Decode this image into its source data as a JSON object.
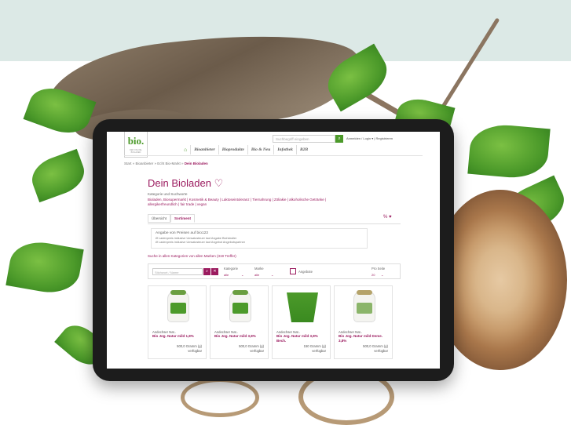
{
  "site": {
    "logo_text": "bio.",
    "logo_sub": "DER ONLINE-BIOLADEN",
    "search_placeholder": "Suchbegriff eingeben",
    "search_icon": "search-icon",
    "top_right": "Anmelden / Login ▾  |  Registrieren",
    "home_icon": "home-icon",
    "nav": [
      "Bioanbieter",
      "Bioprodukte",
      "Bio & Neu",
      "Infothek",
      "B2B"
    ]
  },
  "breadcrumb": {
    "path": "Start » Bioanbieter » Echt Bio-Markt » ",
    "current": "Dein Bioladen"
  },
  "page": {
    "title": "Dein Bioladen",
    "heart_icon": "heart-icon",
    "categories_label": "Kategorie und Suchworte",
    "categories": "Bioladen, Biosupermarkt | Kosmetik & Beauty | Laktoseintoleranz | Tiernahrung | Zöliakie | alkoholische Getränke | allergikerfreundlich | fair trade | vegan"
  },
  "tabs": {
    "items": [
      "Übersicht",
      "Sortiment"
    ],
    "active": 1,
    "icons": "% ♥"
  },
  "info": {
    "heading": "Angabe von Preisen auf bio123",
    "line1": "Ø Ladenpreis inklusive Umsatzsteuer laut Angabe Biohändler",
    "line2": "Ø Ladenpreis inklusive Umsatzsteuer laut Angebot Angebotspartner"
  },
  "search_all": "Suche in allen Kategorien von allen Marken (319 Treffer)",
  "filters": {
    "search_placeholder": "Stichwort / Name",
    "kategorie_label": "Kategorie",
    "kategorie_value": "alle",
    "marke_label": "Marke",
    "marke_value": "alle",
    "angebote_label": "Angebote",
    "pro_seite_label": "Pro Seite",
    "pro_seite_value": "20"
  },
  "products": [
    {
      "brand": "Andechser Nat..",
      "name": "Bio Jog. Natur mild 1,8%",
      "weight": "500,0 Gramm (g)",
      "availability": "verfügbar"
    },
    {
      "brand": "Andechser Nat..",
      "name": "Bio Jog. Natur mild 3,8%",
      "weight": "500,0 Gramm (g)",
      "availability": "verfügbar"
    },
    {
      "brand": "Andechser Nat..",
      "name": "Bio Jog. Natur mild 3,8% Bech.",
      "weight": "150 Gramm (g)",
      "availability": "verfügbar"
    },
    {
      "brand": "Andechser Nat..",
      "name": "Bio Jog. Natur mild Deme. 3,8%",
      "weight": "500,0 Gramm (g)",
      "availability": "verfügbar"
    }
  ],
  "colors": {
    "accent": "#9b1b5f",
    "green": "#4c9a2a"
  }
}
